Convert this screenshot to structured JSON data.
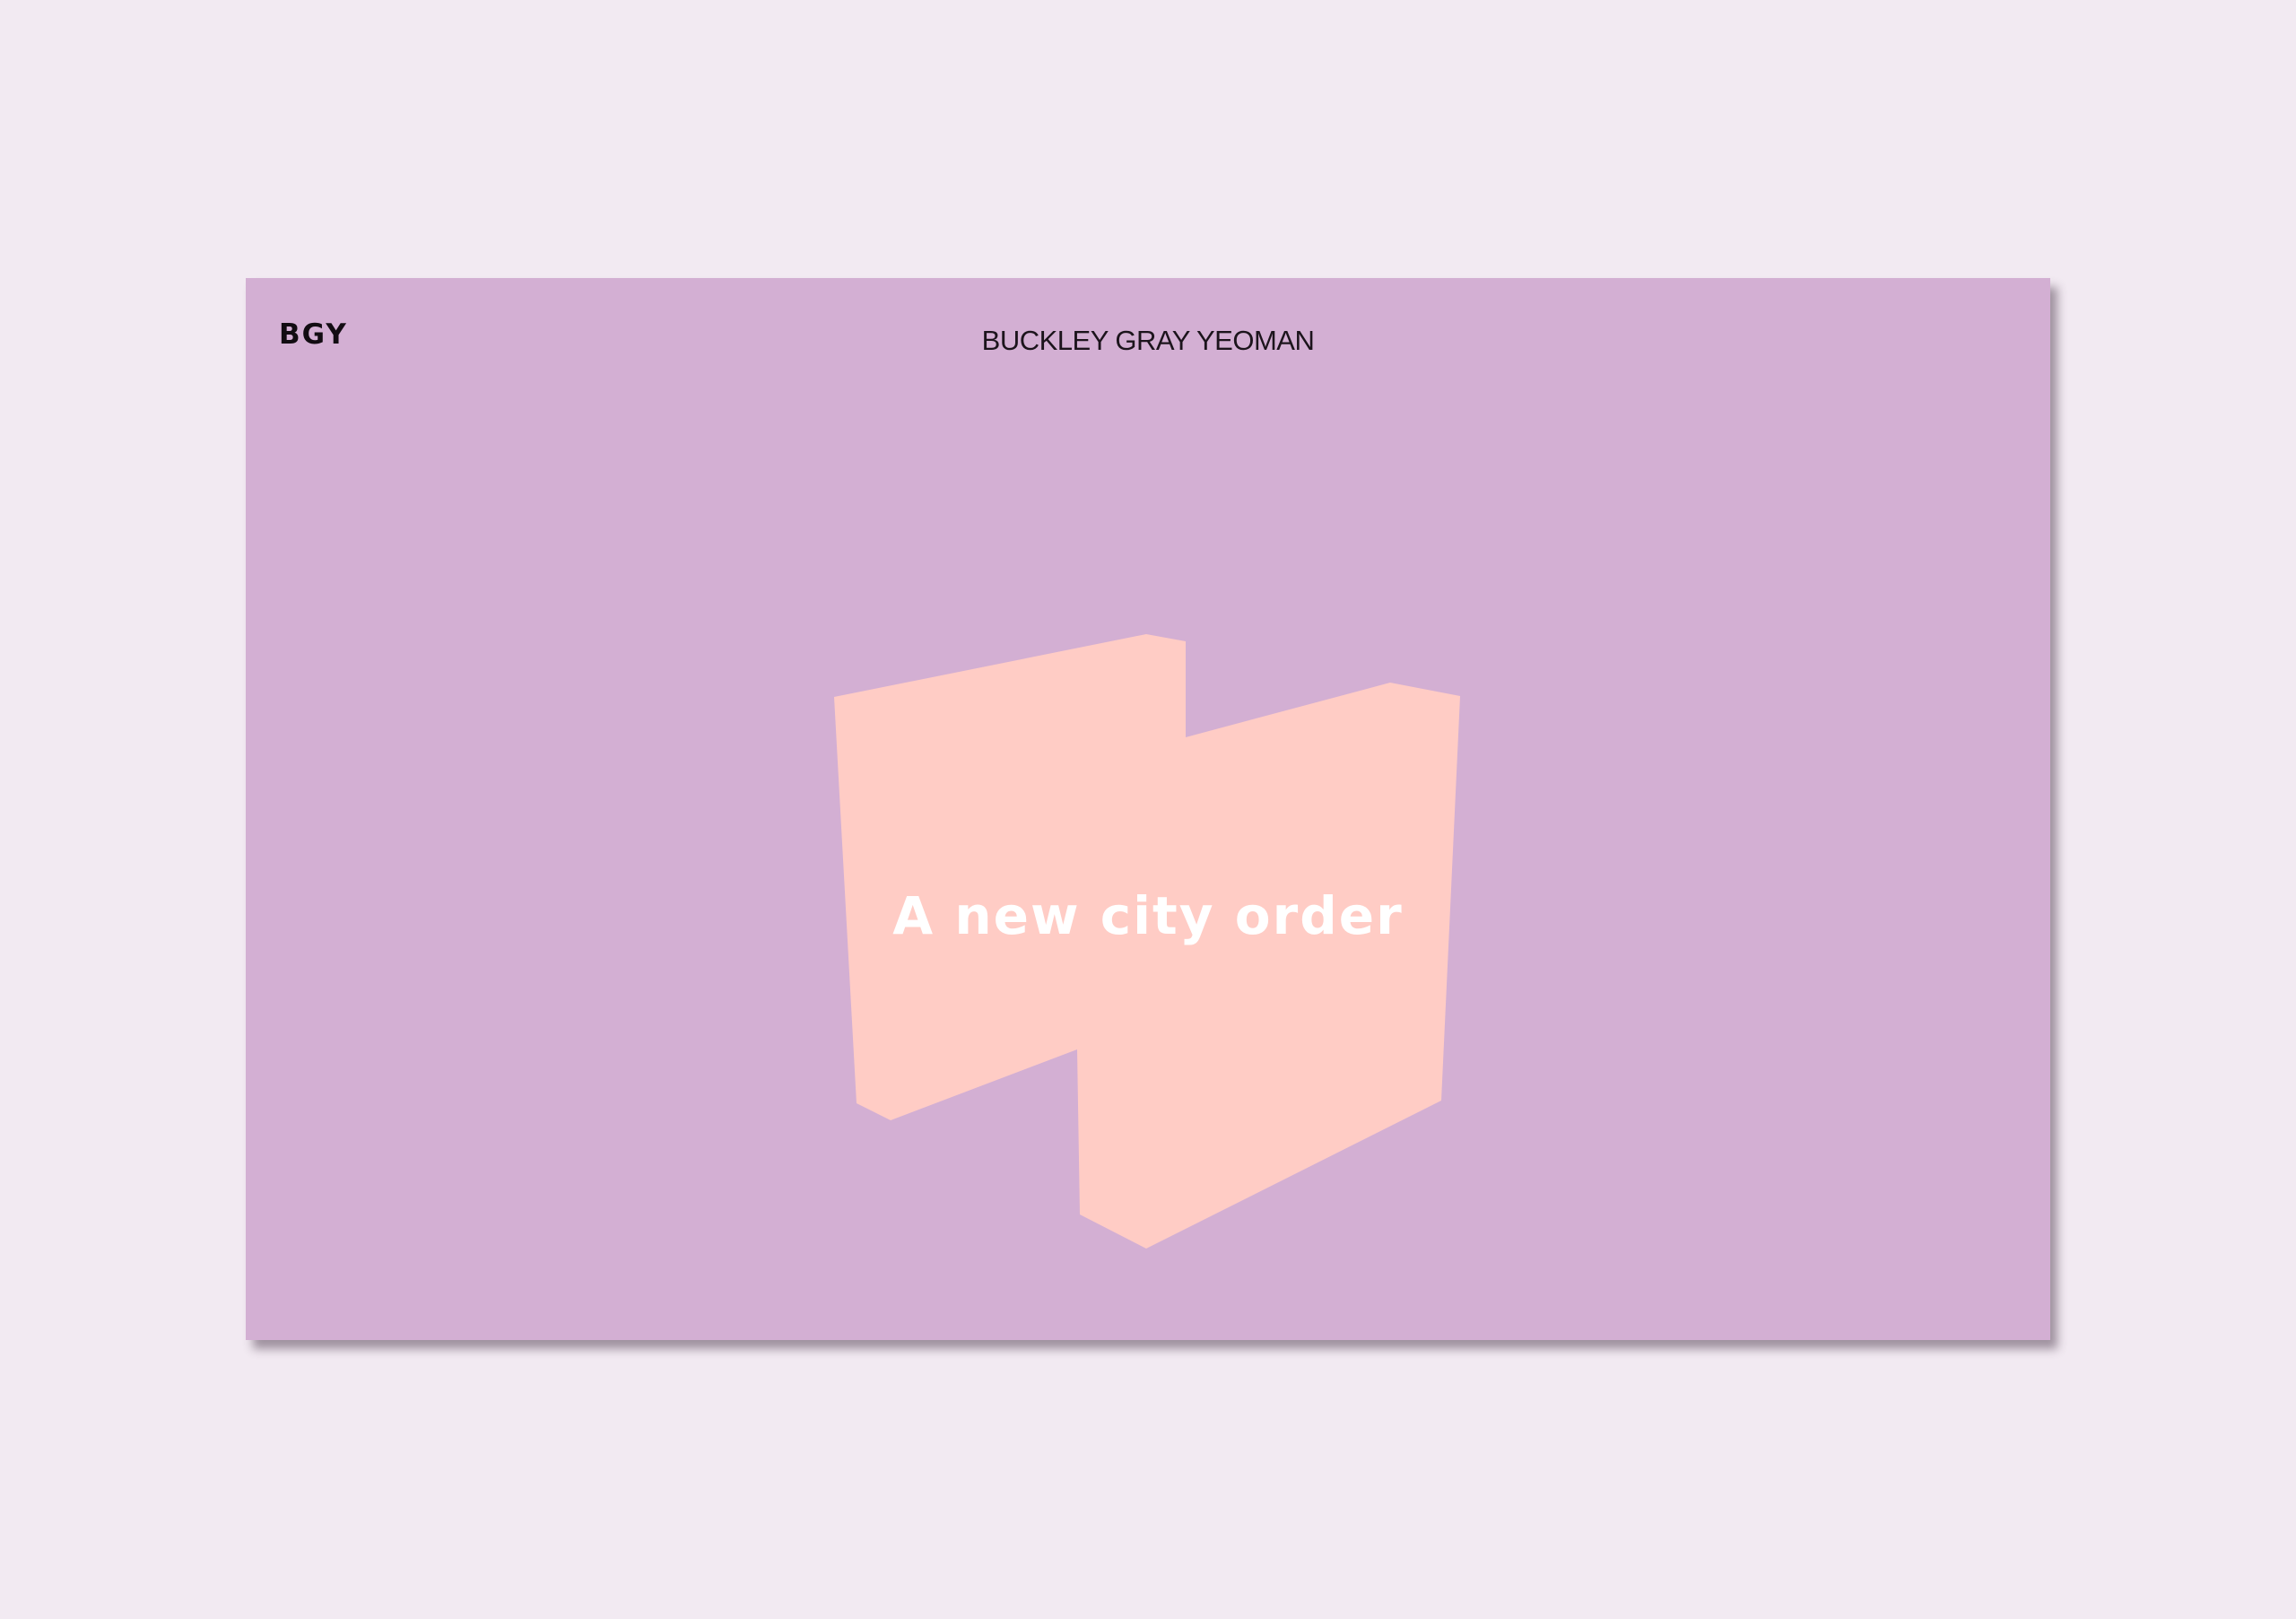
{
  "header": {
    "logo": "BGY",
    "brand_name": "BUCKLEY GRAY YEOMAN"
  },
  "hero": {
    "headline": "A new city order",
    "shape_icon": "stepped-block-shape"
  },
  "colors": {
    "page_background": "#f2eaf2",
    "frame_background": "#d3afd3",
    "shape_fill": "#ffccc5",
    "headline_text": "#ffffff",
    "brand_text": "#1c141c",
    "logo_text": "#120c12"
  }
}
